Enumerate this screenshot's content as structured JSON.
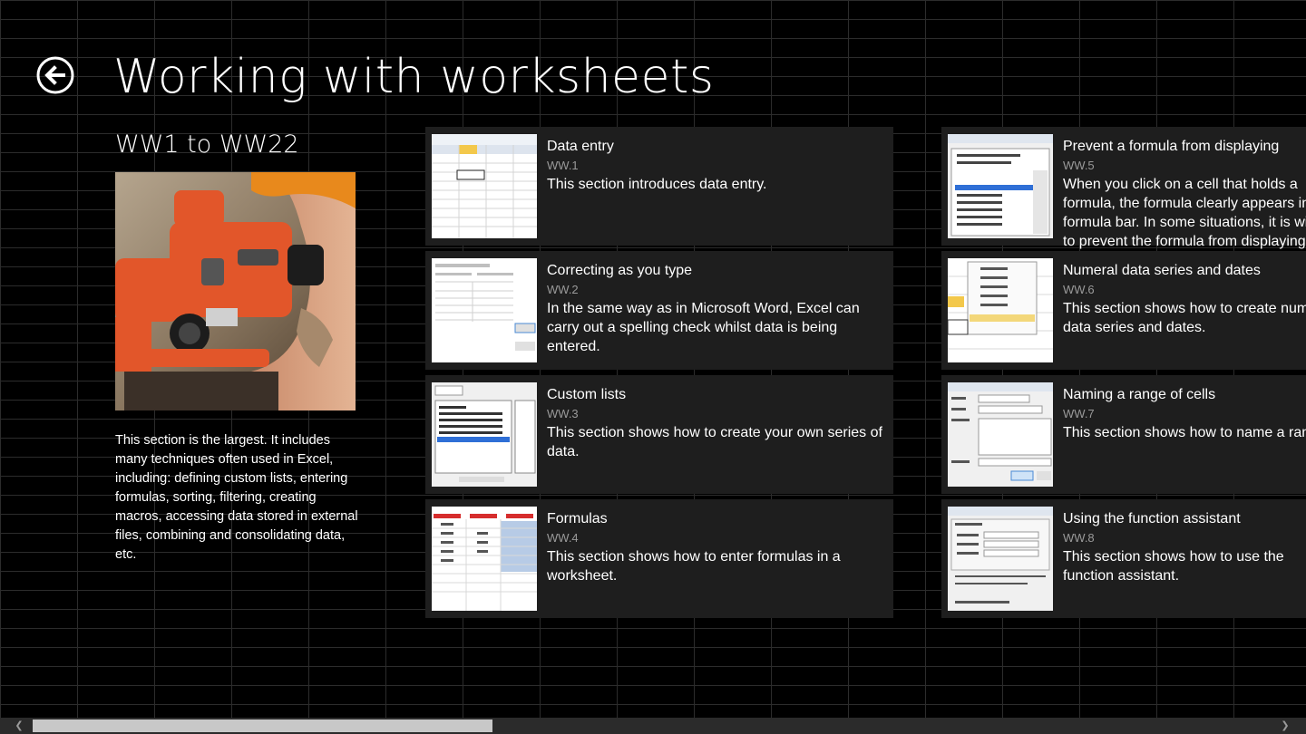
{
  "header": {
    "title": "Working with worksheets",
    "back_icon": "back-arrow-icon"
  },
  "group": {
    "subtitle": "WW1 to WW22",
    "description": "This section is the largest. It includes many techniques often used in Excel, including: defining custom lists, entering formulas, sorting, filtering, creating macros, accessing data stored in external files, combining and consolidating data, etc."
  },
  "items": [
    {
      "title": "Data entry",
      "code": "WW.1",
      "description": "This section introduces data entry."
    },
    {
      "title": "Correcting as you type",
      "code": "WW.2",
      "description": "In the same way as in Microsoft Word, Excel can carry out a spelling check whilst data is being entered."
    },
    {
      "title": "Custom lists",
      "code": "WW.3",
      "description": "This section shows how to create your own series of data."
    },
    {
      "title": "Formulas",
      "code": "WW.4",
      "description": "This section shows how to enter formulas in a worksheet."
    },
    {
      "title": "Prevent a formula from displaying",
      "code": "WW.5",
      "description": "When you click on a cell that holds a formula, the formula clearly appears in the formula bar. In some situations, it is wise to prevent the formula from displaying."
    },
    {
      "title": "Numeral data series and dates",
      "code": "WW.6",
      "description": "This section shows how to create numeral data series and dates."
    },
    {
      "title": "Naming a range of cells",
      "code": "WW.7",
      "description": "This section shows how to name a range of cells."
    },
    {
      "title": "Using the function assistant",
      "code": "WW.8",
      "description": "This section shows how to use the function assistant."
    }
  ],
  "colors": {
    "background": "#000000",
    "card": "#1e1e1e",
    "code_text": "#9a9a9a",
    "surveyor_orange": "#e2562a"
  },
  "scrollbar": {
    "left_icon": "chevron-left-icon",
    "right_icon": "chevron-right-icon",
    "position_fraction": 0.0
  }
}
